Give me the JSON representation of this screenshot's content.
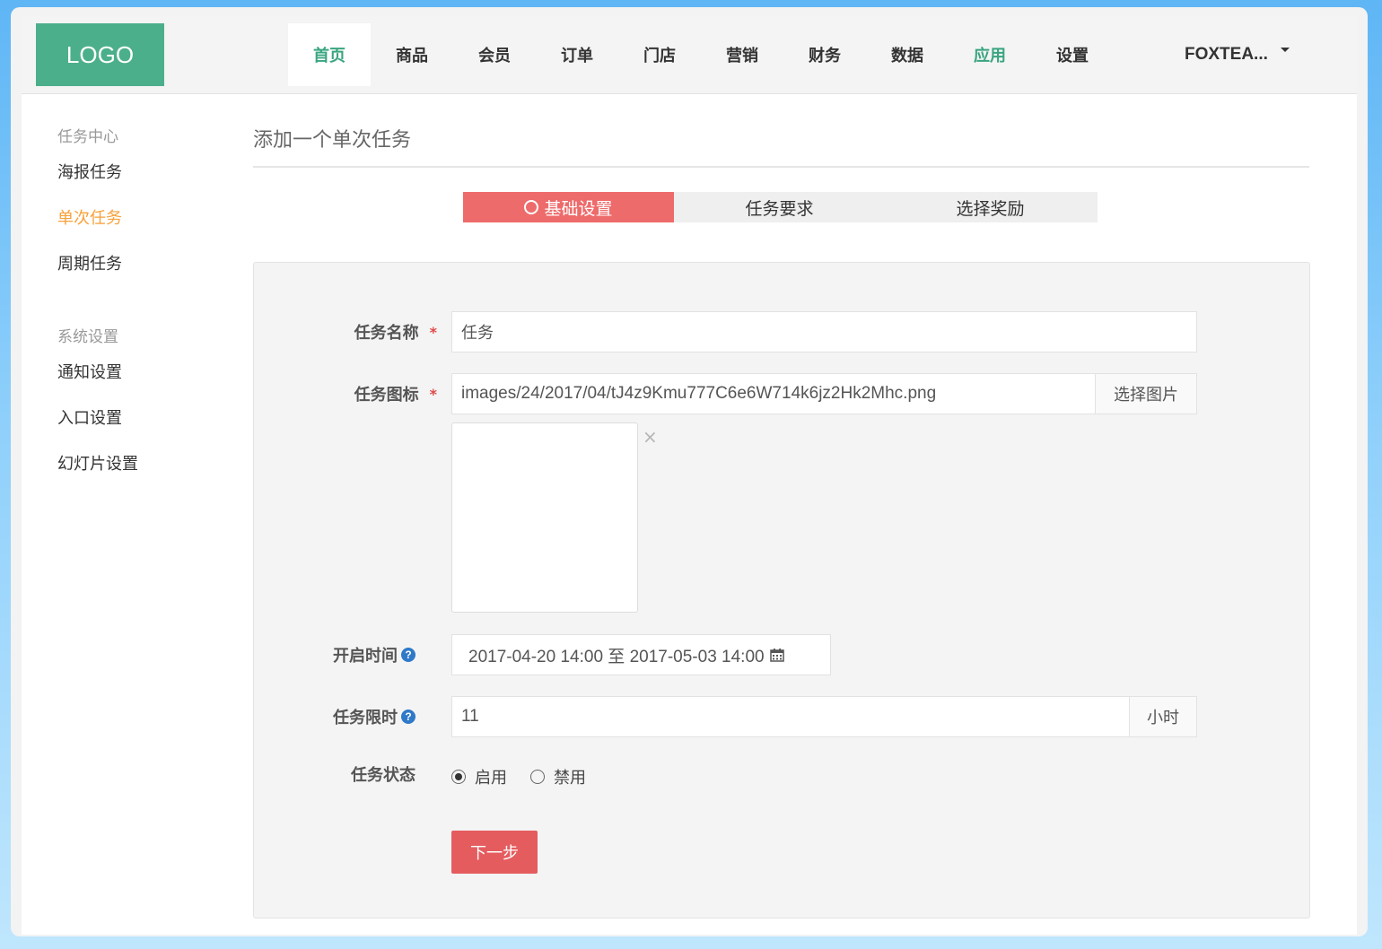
{
  "brand": {
    "logo_text": "LOGO"
  },
  "nav": {
    "items": [
      "首页",
      "商品",
      "会员",
      "订单",
      "门店",
      "营销",
      "财务",
      "数据",
      "应用",
      "设置"
    ],
    "user_label": "FOXTEA..."
  },
  "sidebar": {
    "group1": "任务中心",
    "items1": [
      "海报任务",
      "单次任务",
      "周期任务"
    ],
    "group2": "系统设置",
    "items2": [
      "通知设置",
      "入口设置",
      "幻灯片设置"
    ]
  },
  "main": {
    "title": "添加一个单次任务",
    "steps": [
      "基础设置",
      "任务要求",
      "选择奖励"
    ]
  },
  "form": {
    "name_label": "任务名称",
    "name_value": "任务",
    "icon_label": "任务图标",
    "icon_value": "images/24/2017/04/tJ4z9Kmu777C6e6W714k6jz2Hk2Mhc.png",
    "icon_button": "选择图片",
    "time_label": "开启时间",
    "time_value": "2017-04-20 14:00 至 2017-05-03 14:00",
    "limit_label": "任务限时",
    "limit_value": "11",
    "limit_unit": "小时",
    "status_label": "任务状态",
    "status_options": [
      "启用",
      "禁用"
    ],
    "status_selected": "启用",
    "next_button": "下一步",
    "required_mark": "*",
    "help_mark": "?",
    "close_mark": "×"
  },
  "colors": {
    "accent_green": "#3aa57f",
    "accent_red": "#ee6b6b",
    "active_orange": "#f7a23b"
  }
}
